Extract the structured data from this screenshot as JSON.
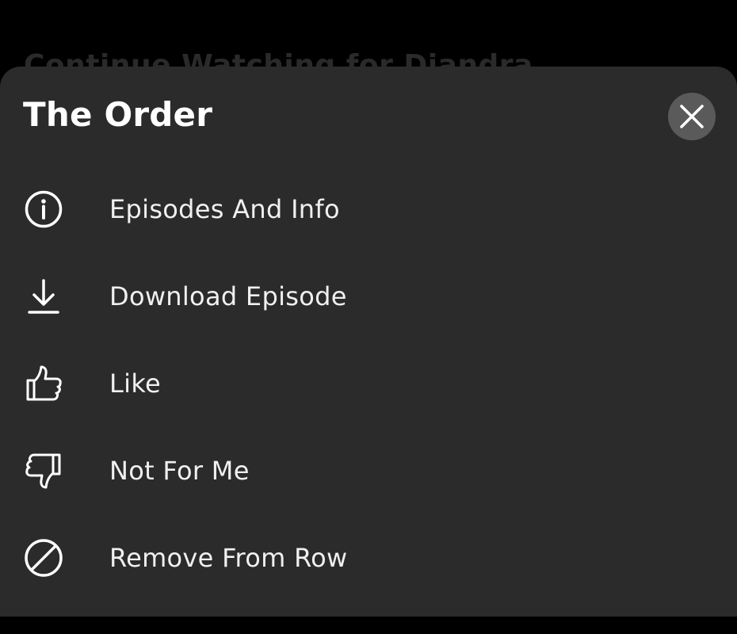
{
  "background": {
    "row_title": "Continue Watching for Diandra"
  },
  "sheet": {
    "title": "The Order",
    "close_icon": "close-icon",
    "items": [
      {
        "label": "Episodes And Info",
        "icon": "info-icon"
      },
      {
        "label": "Download Episode",
        "icon": "download-icon"
      },
      {
        "label": "Like",
        "icon": "thumbs-up-icon"
      },
      {
        "label": "Not For Me",
        "icon": "thumbs-down-icon"
      },
      {
        "label": "Remove From Row",
        "icon": "remove-icon"
      }
    ]
  },
  "colors": {
    "background": "#000000",
    "sheet": "#2b2b2b",
    "close_button": "#5a5a5a",
    "text": "#ffffff"
  }
}
